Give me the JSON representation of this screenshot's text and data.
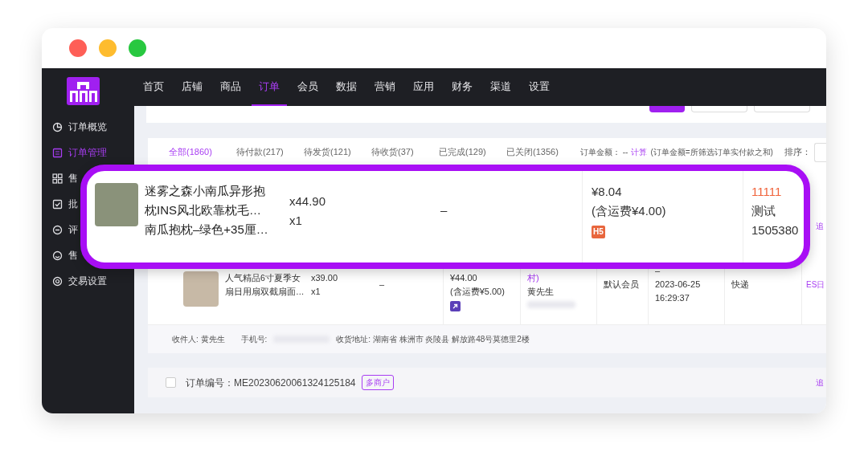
{
  "top_nav": {
    "items": [
      {
        "label": "首页",
        "selected": false
      },
      {
        "label": "店铺",
        "selected": false
      },
      {
        "label": "商品",
        "selected": false
      },
      {
        "label": "订单",
        "selected": true
      },
      {
        "label": "会员",
        "selected": false
      },
      {
        "label": "数据",
        "selected": false
      },
      {
        "label": "营销",
        "selected": false
      },
      {
        "label": "应用",
        "selected": false
      },
      {
        "label": "财务",
        "selected": false
      },
      {
        "label": "渠道",
        "selected": false
      },
      {
        "label": "设置",
        "selected": false
      }
    ]
  },
  "sidebar": {
    "items": [
      {
        "label": "订单概览",
        "selected": false
      },
      {
        "label": "订单管理",
        "selected": true
      },
      {
        "label": "售",
        "selected": false
      },
      {
        "label": "批",
        "selected": false
      },
      {
        "label": "评",
        "selected": false
      },
      {
        "label": "售",
        "selected": false
      },
      {
        "label": "交易设置",
        "selected": false
      }
    ]
  },
  "toolbar": {
    "buttons": [
      {
        "kind": "primary"
      },
      {
        "kind": "outline"
      },
      {
        "kind": "outline"
      }
    ]
  },
  "tabs": [
    {
      "label": "全部(1860)",
      "selected": true
    },
    {
      "label": "待付款(217)",
      "selected": false
    },
    {
      "label": "待发货(121)",
      "selected": false
    },
    {
      "label": "待收货(37)",
      "selected": false
    },
    {
      "label": "已完成(129)",
      "selected": false
    },
    {
      "label": "已关闭(1356)",
      "selected": false
    }
  ],
  "summary": {
    "label": "订单金额：",
    "value": "--",
    "link": "计算",
    "note": "(订单金额=所筛选订单实付款之和)",
    "sort_label": "排序："
  },
  "order_row": {
    "product": "人气精品6寸夏季女扇日用扇双截扇面…",
    "price": "x39.00",
    "quantity": "x1",
    "column_3": "–",
    "total": "¥44.00",
    "shipping": "(含运费¥5.00)",
    "buyer_link": "村)",
    "buyer_name": "黄先生",
    "member": "默认会员",
    "time_dash": "–",
    "time": "2023-06-25 16:29:37",
    "delivery": "快递",
    "action": "ES日"
  },
  "address": {
    "receiver": "收件人: 黄先生",
    "phone_label": "手机号:",
    "address": "收货地址: 湖南省 株洲市 炎陵县 解放路48号莫德里2楼"
  },
  "order_header": {
    "checked": false,
    "number": "订单编号：ME20230620061324125184",
    "tag": "多商户",
    "action": "追"
  },
  "first_order_action": "追",
  "callout": {
    "product_lines": [
      "迷雾之森小南瓜异形抱",
      "枕INS风北欧靠枕毛…",
      "南瓜抱枕–绿色+35厘…"
    ],
    "price": "x44.90",
    "quantity": "x1",
    "column_3": "–",
    "total": "¥8.04",
    "shipping": "(含运费¥4.00)",
    "source": "H5",
    "buyer_id": "11111",
    "buyer_name": "测试",
    "buyer_phone": "1505380"
  }
}
